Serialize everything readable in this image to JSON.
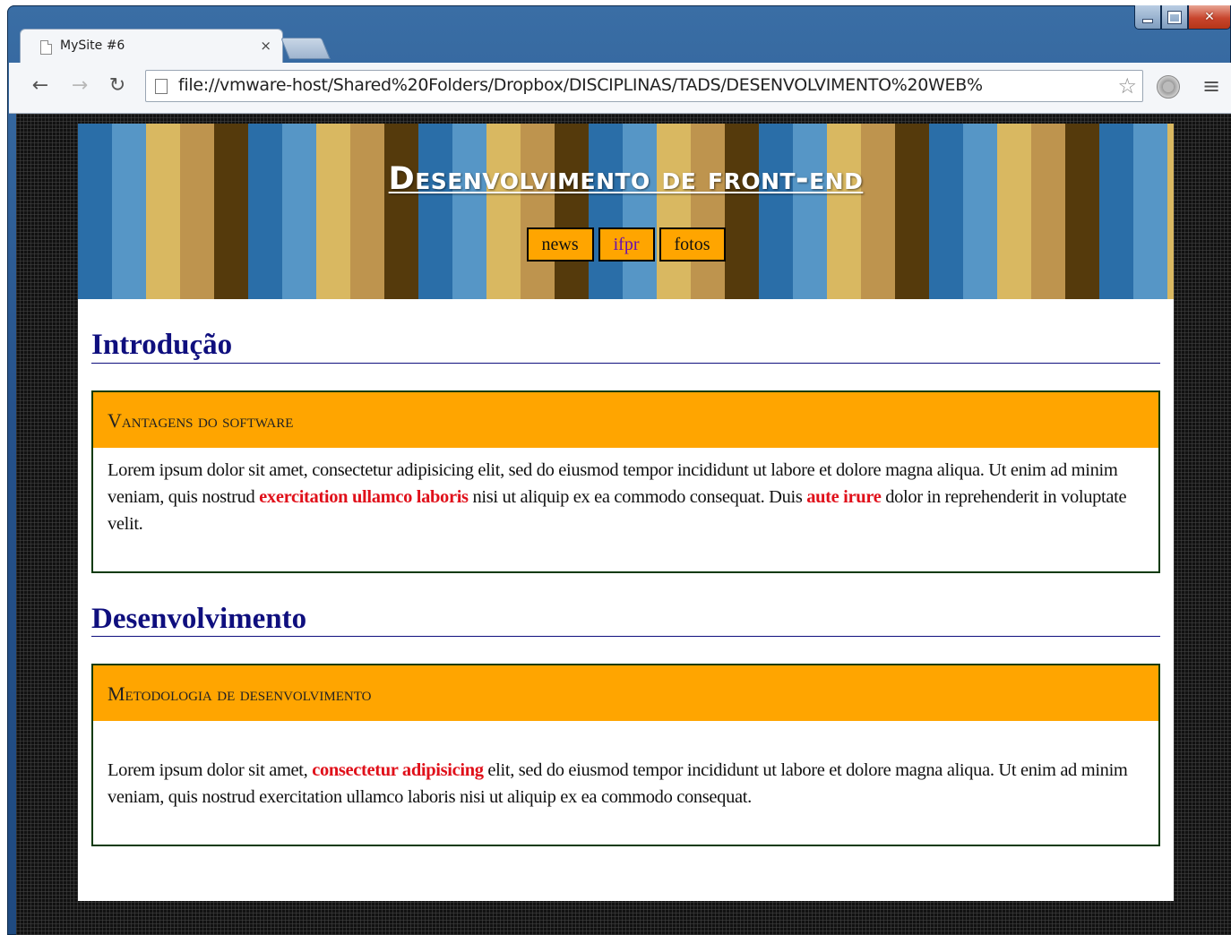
{
  "browser": {
    "tab_title": "MySite #6",
    "tab_close": "×",
    "url": "file://vmware-host/Shared%20Folders/Dropbox/DISCIPLINAS/TADS/DESENVOLVIMENTO%20WEB%",
    "icons": [
      "back-icon",
      "forward-icon",
      "reload-icon",
      "page-icon",
      "star-icon",
      "extension-icon",
      "menu-icon"
    ]
  },
  "site": {
    "title": "Desenvolvimento de front-end",
    "nav": [
      {
        "label": "news",
        "visited": false
      },
      {
        "label": "ifpr",
        "visited": true
      },
      {
        "label": "fotos",
        "visited": false
      }
    ]
  },
  "sections": [
    {
      "title": "Introdução",
      "card_title": "Vantagens do software",
      "body": [
        {
          "text": "Lorem ipsum dolor sit amet, consectetur adipisicing elit, sed do eiusmod tempor incididunt ut labore et dolore magna aliqua. Ut enim ad minim veniam, quis nostrud ",
          "highlight": false
        },
        {
          "text": "exercitation ullamco laboris",
          "highlight": true
        },
        {
          "text": " nisi ut aliquip ex ea commodo consequat. Duis ",
          "highlight": false
        },
        {
          "text": "aute irure",
          "highlight": true
        },
        {
          "text": " dolor in reprehenderit in voluptate velit.",
          "highlight": false
        }
      ]
    },
    {
      "title": "Desenvolvimento",
      "card_title": "Metodologia de desenvolvimento",
      "body": [
        {
          "text": "Lorem ipsum dolor sit amet, ",
          "highlight": false
        },
        {
          "text": "consectetur adipisicing",
          "highlight": true
        },
        {
          "text": " elit, sed do eiusmod tempor incididunt ut labore et dolore magna aliqua. Ut enim ad minim veniam, quis nostrud exercitation ullamco laboris nisi ut aliquip ex ea commodo consequat.",
          "highlight": false
        }
      ]
    }
  ],
  "colors": {
    "nav_bg": "#ffa500",
    "card_header": "#ffa500",
    "section_title": "#0f0f7e",
    "highlight": "#e0101a",
    "stripes": [
      "#2a6ea8",
      "#5696c6",
      "#d9b861",
      "#be944e",
      "#553a0c"
    ]
  }
}
